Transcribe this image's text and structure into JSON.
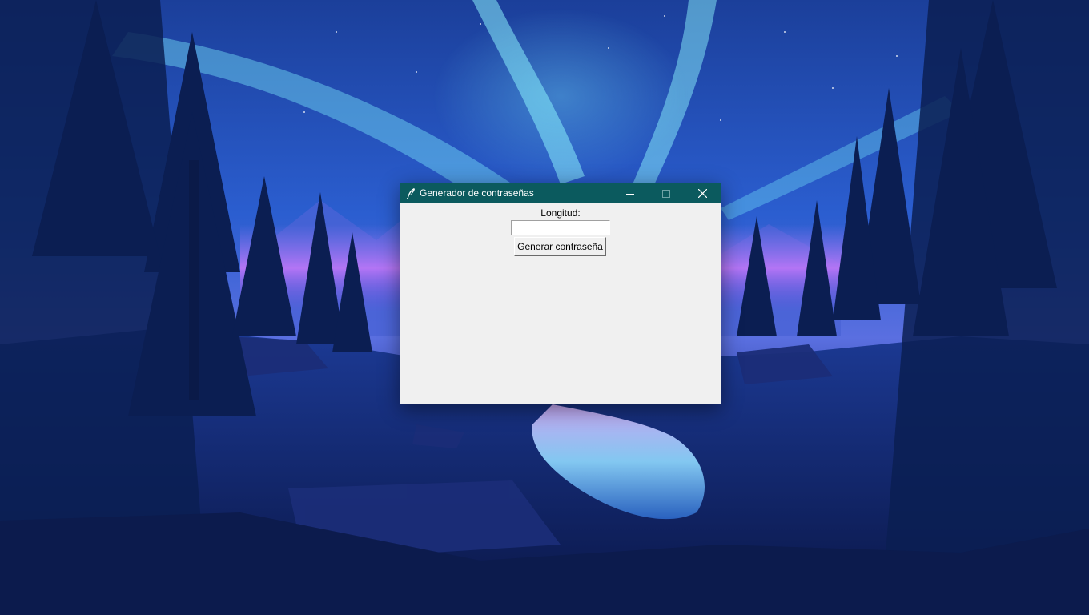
{
  "desktop": {
    "wallpaper": "aurora-forest-night"
  },
  "window": {
    "title": "Generador de contraseñas",
    "app_icon": "feather-icon",
    "controls": {
      "minimize_icon": "minimize-icon",
      "maximize_icon": "maximize-icon",
      "close_icon": "close-icon"
    },
    "titlebar_color": "#0b5a5e",
    "client_color": "#f0f0f0"
  },
  "form": {
    "length_label": "Longitud:",
    "length_value": "",
    "length_placeholder": "",
    "generate_button_label": "Generar contraseña"
  }
}
